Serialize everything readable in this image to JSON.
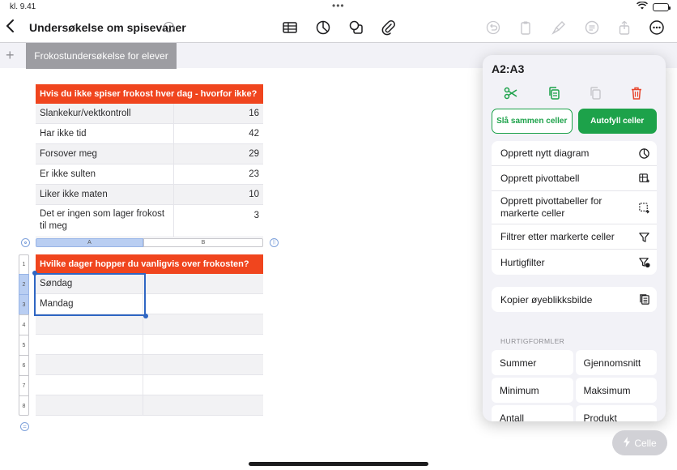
{
  "status": {
    "time": "kl. 9.41",
    "dots": "•••"
  },
  "toolbar": {
    "doc_title": "Undersøkelse om spisevaner",
    "chevron": "⌄"
  },
  "tabs": {
    "add": "+",
    "active": "Frokostundersøkelse for elever"
  },
  "table1": {
    "header": "Hvis du ikke spiser frokost hver dag - hvorfor ikke?",
    "rows": [
      {
        "label": "Slankekur/vektkontroll",
        "value": "16"
      },
      {
        "label": "Har ikke tid",
        "value": "42"
      },
      {
        "label": "Forsover meg",
        "value": "29"
      },
      {
        "label": "Er ikke sulten",
        "value": "23"
      },
      {
        "label": "Liker ikke maten",
        "value": "10"
      },
      {
        "label": "Det er ingen som lager frokost til meg",
        "value": "3"
      }
    ]
  },
  "table2": {
    "col_headers": [
      "A",
      "B"
    ],
    "row_headers": [
      "1",
      "2",
      "3",
      "4",
      "5",
      "6",
      "7",
      "8"
    ],
    "header": "Hvilke dager hopper du vanligvis over frokosten?",
    "rows": [
      "Søndag",
      "Mandag",
      "",
      "",
      "",
      "",
      ""
    ],
    "eq": "="
  },
  "popover": {
    "title": "A2:A3",
    "merge_label": "Slå sammen celler",
    "autofill_label": "Autofyll celler",
    "menu1": [
      "Opprett nytt diagram",
      "Opprett pivottabell",
      "Opprett pivottabeller for markerte celler",
      "Filtrer etter markerte celler",
      "Hurtigfilter"
    ],
    "menu2": [
      "Kopier øyeblikksbilde"
    ],
    "section_label": "HURTIGFORMLER",
    "formulas": [
      "Summer",
      "Gjennomsnitt",
      "Minimum",
      "Maksimum",
      "Antall",
      "Produkt"
    ]
  },
  "cell_button": {
    "label": "Celle"
  },
  "colors": {
    "accent_red": "#f0451e",
    "green": "#1da24a",
    "selection_blue": "#2f66c3"
  }
}
